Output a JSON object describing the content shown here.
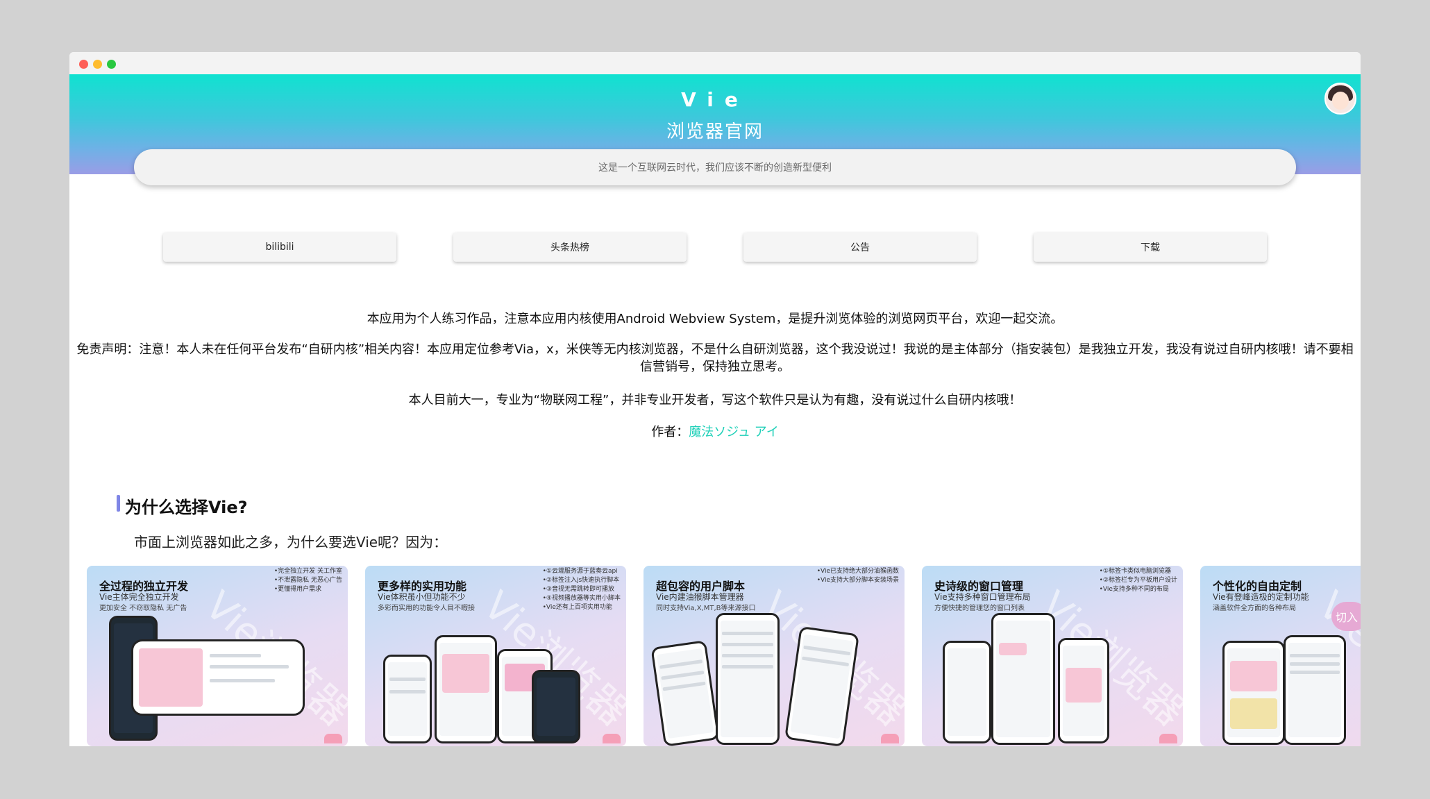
{
  "header": {
    "logo_text": "Vie",
    "title": "浏览器官网",
    "search_placeholder": "这是一个互联网云时代，我们应该不断的创造新型便利"
  },
  "nav": {
    "buttons": [
      "bilibili",
      "头条热榜",
      "公告",
      "下载"
    ]
  },
  "intro": {
    "line1": "本应用为个人练习作品，注意本应用内核使用Android Webview System，是提升浏览体验的浏览网页平台，欢迎一起交流。",
    "disclaimer": "免责声明：注意！本人未在任何平台发布“自研内核”相关内容！本应用定位参考Via，x，米侠等无内核浏览器，不是什么自研浏览器，这个我没说过！我说的是主体部分（指安装包）是我独立开发，我没有说过自研内核哦！请不要相信营销号，保持独立思考。",
    "line3": "本人目前大一，专业为“物联网工程”，并非专业开发者，写这个软件只是认为有趣，没有说过什么自研内核哦！",
    "author_label": "作者：",
    "author_name": "魔法ソジュ アイ"
  },
  "section": {
    "title": "为什么选择Vie?",
    "subtitle": "市面上浏览器如此之多，为什么要选Vie呢？因为："
  },
  "cards": [
    {
      "title": "全过程的独立开发",
      "sub": "Vie主体完全独立开发",
      "tag": "更加安全 不窃取隐私 无广告",
      "notes": [
        "•完全独立开发 关工作室",
        "•不泄露隐私 无恶心广告",
        "•更懂得用户需求"
      ],
      "watermark": "Vie浏览器"
    },
    {
      "title": "更多样的实用功能",
      "sub": "Vie体积虽小但功能不少",
      "tag": "多彩而实用的功能令人目不暇接",
      "notes": [
        "•①云端服务源于蓝奏云api",
        "•②标签注入js快速执行脚本",
        "•③音视无需跳转即可播放",
        "•④视频播放器等实用小脚本",
        "•Vie还有上百项实用功能"
      ],
      "watermark": "Vie浏览器"
    },
    {
      "title": "超包容的用户脚本",
      "sub": "Vie内建油猴脚本管理器",
      "tag": "同时支持Via,X,MT,B等来源接口",
      "notes": [
        "•Vie已支持绝大部分油猴函数",
        "•Vie支持大部分脚本安装场景"
      ],
      "watermark": "Vie浏览器"
    },
    {
      "title": "史诗级的窗口管理",
      "sub": "Vie支持多种窗口管理布局",
      "tag": "方便快捷的管理您的窗口列表",
      "notes": [
        "•①标签卡类似电脑浏览器",
        "•②标签栏专为平板用户设计",
        "•Vie支持多种不同的布局"
      ],
      "watermark": "Vie浏览器"
    },
    {
      "title": "个性化的自由定制",
      "sub": "Vie有登峰造极的定制功能",
      "tag": "涵盖软件全方面的各种布局",
      "notes": [],
      "watermark": "Vie浏览器"
    }
  ],
  "float_button": "切入",
  "colors": {
    "accent": "#1fd0b8",
    "hero_top": "#10e2d0",
    "hero_bottom": "#9a9de6",
    "section_bar": "#7f86e6"
  }
}
